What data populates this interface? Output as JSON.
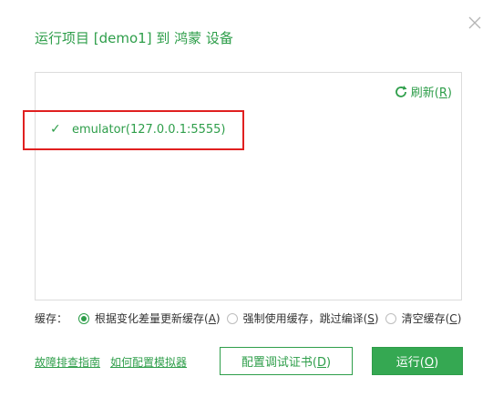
{
  "dialog": {
    "title": "运行项目 [demo1] 到 鸿蒙 设备",
    "close_icon": "close-icon"
  },
  "device_panel": {
    "refresh_label": "刷新(",
    "refresh_key": "R",
    "refresh_suffix": ")",
    "devices": [
      {
        "name": "emulator(127.0.0.1:5555)",
        "selected": true
      }
    ]
  },
  "cache": {
    "label": "缓存：",
    "options": [
      {
        "text": "根据变化差量更新缓存(",
        "key": "A",
        "suffix": ")",
        "checked": true
      },
      {
        "text": "强制使用缓存，跳过编译(",
        "key": "S",
        "suffix": ")",
        "checked": false
      },
      {
        "text": "清空缓存(",
        "key": "C",
        "suffix": ")",
        "checked": false
      }
    ]
  },
  "footer": {
    "link_troubleshoot": "故障排查指南",
    "link_emulator": "如何配置模拟器",
    "config_cert_text": "配置调试证书(",
    "config_cert_key": "D",
    "config_cert_suffix": ")",
    "run_text": "运行(",
    "run_key": "O",
    "run_suffix": ")"
  },
  "colors": {
    "accent": "#2e9e4a",
    "primary_button": "#35a852",
    "highlight": "#e02020"
  }
}
